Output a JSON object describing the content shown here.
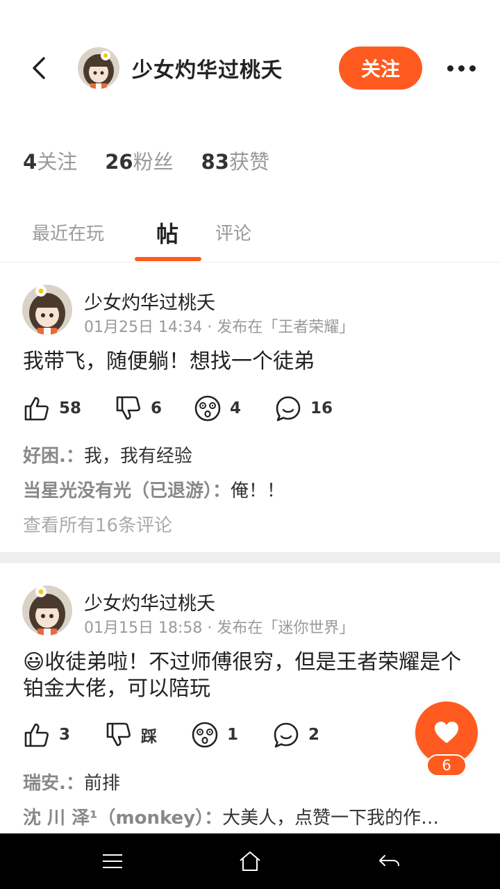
{
  "header": {
    "user_name": "少女灼华过桃夭",
    "follow_label": "关注"
  },
  "stats": [
    {
      "num": "4",
      "label": "关注"
    },
    {
      "num": "26",
      "label": "粉丝"
    },
    {
      "num": "83",
      "label": "获赞"
    }
  ],
  "tabs": [
    {
      "label": "最近在玩"
    },
    {
      "label": "帖"
    },
    {
      "label": "评论"
    }
  ],
  "posts": [
    {
      "author": "少女灼华过桃夭",
      "meta": "01月25日 14:34 · 发布在「王者荣耀」",
      "text": "我带飞，随便躺！想找一个徒弟",
      "likes": "58",
      "dislikes": "6",
      "wows": "4",
      "comments": "16",
      "comment_list": [
        {
          "who": "好困.：",
          "text": "我，我有经验"
        },
        {
          "who": "当星光没有光（已退游）：",
          "text": "俺！！"
        }
      ],
      "view_all": "查看所有16条评论"
    },
    {
      "author": "少女灼华过桃夭",
      "meta": "01月15日 18:58 · 发布在「迷你世界」",
      "emoji": "😃",
      "text": "收徒弟啦！不过师傅很穷，但是王者荣耀是个铂金大佬，可以陪玩",
      "likes": "3",
      "dislikes": "踩",
      "wows": "1",
      "comments": "2",
      "comment_list": [
        {
          "who": "瑞安.：",
          "text": "前排"
        },
        {
          "who": "沈 川 泽¹（monkey）：",
          "text": "大美人，点赞一下我的作…"
        }
      ]
    }
  ],
  "fab": {
    "count": "6"
  },
  "colors": {
    "accent": "#ff5a1f",
    "muted": "#999999"
  }
}
